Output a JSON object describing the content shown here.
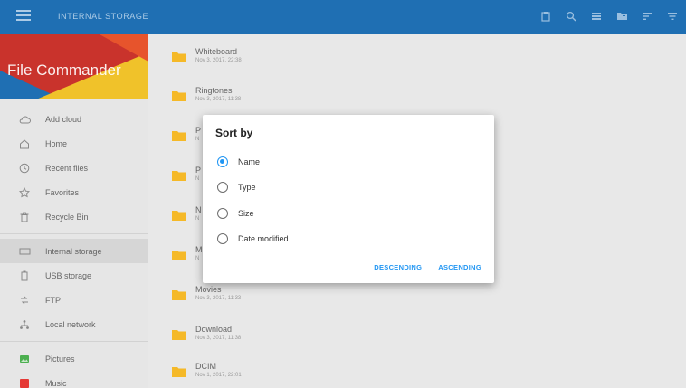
{
  "topbar": {
    "title": "INTERNAL STORAGE",
    "actions": [
      "clipboard-icon",
      "search-icon",
      "view-toggle-icon",
      "new-folder-icon",
      "sort-icon",
      "filter-icon"
    ]
  },
  "sidebar": {
    "app_title": "File Commander",
    "items_group1": [
      {
        "label": "Add cloud",
        "icon": "cloud-icon"
      },
      {
        "label": "Home",
        "icon": "home-icon"
      },
      {
        "label": "Recent files",
        "icon": "clock-icon"
      },
      {
        "label": "Favorites",
        "icon": "star-icon"
      },
      {
        "label": "Recycle Bin",
        "icon": "trash-icon"
      }
    ],
    "items_group2": [
      {
        "label": "Internal storage",
        "icon": "storage-icon"
      },
      {
        "label": "USB storage",
        "icon": "usb-icon"
      },
      {
        "label": "FTP",
        "icon": "ftp-icon"
      },
      {
        "label": "Local network",
        "icon": "network-icon"
      }
    ],
    "items_group3": [
      {
        "label": "Pictures",
        "icon": "pictures-icon"
      },
      {
        "label": "Music",
        "icon": "music-icon"
      }
    ]
  },
  "files": [
    {
      "name": "Whiteboard",
      "date": "Nov 3, 2017, 22:38"
    },
    {
      "name": "Ringtones",
      "date": "Nov 3, 2017, 11:38"
    },
    {
      "name": "P",
      "date": "N"
    },
    {
      "name": "P",
      "date": "N"
    },
    {
      "name": "N",
      "date": "N"
    },
    {
      "name": "M",
      "date": "N"
    },
    {
      "name": "Movies",
      "date": "Nov 3, 2017, 11:33"
    },
    {
      "name": "Download",
      "date": "Nov 3, 2017, 11:38"
    },
    {
      "name": "DCIM",
      "date": "Nov 1, 2017, 22:01"
    }
  ],
  "dialog": {
    "title": "Sort by",
    "options": [
      {
        "label": "Name",
        "checked": true
      },
      {
        "label": "Type",
        "checked": false
      },
      {
        "label": "Size",
        "checked": false
      },
      {
        "label": "Date modified",
        "checked": false
      }
    ],
    "descending_label": "DESCENDING",
    "ascending_label": "ASCENDING"
  },
  "colors": {
    "topbar": "#1f6fb3",
    "accent": "#2196f3",
    "folder": "#f5b928"
  }
}
